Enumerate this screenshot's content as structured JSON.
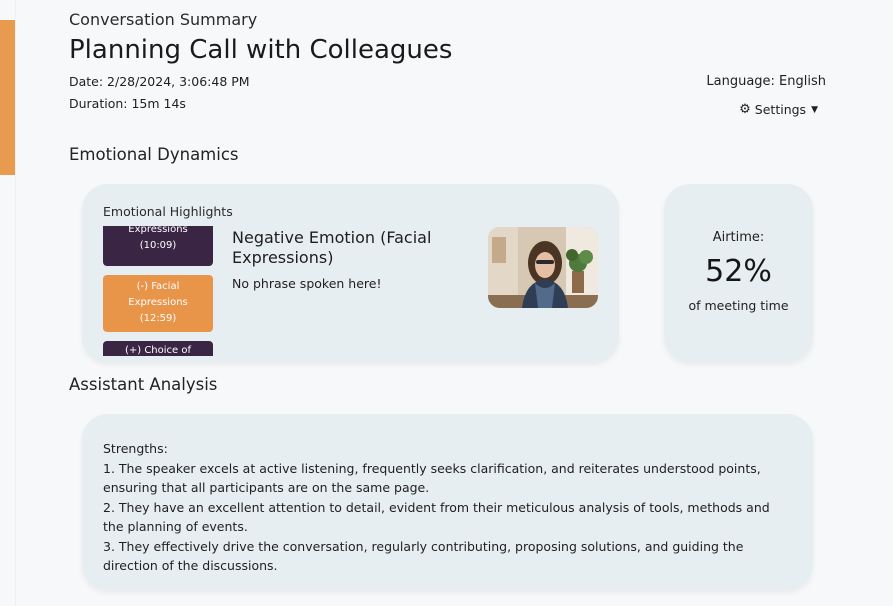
{
  "header": {
    "eyebrow": "Conversation Summary",
    "title": "Planning Call with Colleagues",
    "date": "Date: 2/28/2024, 3:06:48 PM",
    "duration": "Duration: 15m 14s",
    "language": "Language: English",
    "settings_label": "Settings"
  },
  "emotional_dynamics": {
    "heading": "Emotional Dynamics",
    "highlights_label": "Emotional Highlights",
    "highlights": [
      {
        "line1": "Expressions",
        "line2": "(10:09)"
      },
      {
        "line1": "(-) Facial",
        "line2": "Expressions",
        "line3": "(12:59)"
      },
      {
        "line1": "(+) Choice of"
      }
    ],
    "selected": {
      "title": "Negative Emotion (Facial Expressions)",
      "phrase": "No phrase spoken here!"
    }
  },
  "airtime": {
    "label": "Airtime:",
    "value": "52%",
    "sub": "of meeting time"
  },
  "assistant_analysis": {
    "heading": "Assistant Analysis",
    "strengths_label": "Strengths:",
    "items": [
      "1. The speaker excels at active listening, frequently seeks clarification, and reiterates understood points, ensuring that all participants are on the same page.",
      "2. They have an excellent attention to detail, evident from their meticulous analysis of tools, methods and the planning of events.",
      "3. They effectively drive the conversation, regularly contributing, proposing solutions, and guiding the direction of the discussions."
    ]
  },
  "colors": {
    "accent_orange": "#e89a4e",
    "chip_dark": "#3b2545",
    "card_bg": "#e7eef1"
  },
  "icons": {
    "settings": "gear-icon",
    "dropdown": "caret-down-icon"
  }
}
